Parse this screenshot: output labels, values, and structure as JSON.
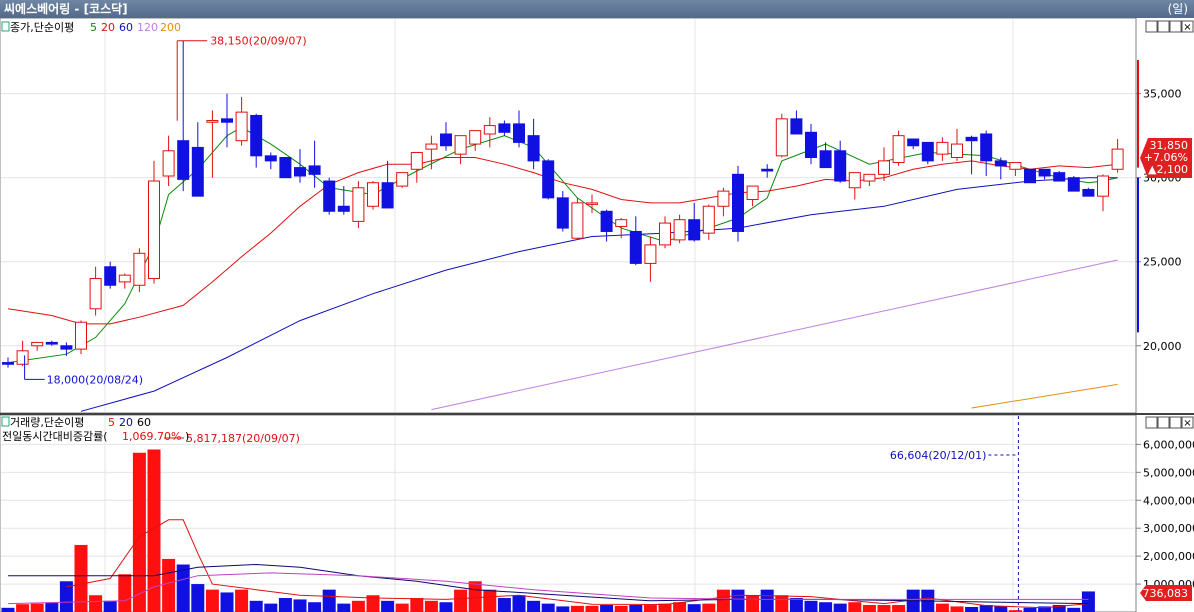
{
  "window": {
    "title": "씨에스베어링 - [코스닥]",
    "period": "(일)"
  },
  "panel_controls": [
    "ㅁ",
    "ㅁ",
    "ㅁ",
    "×"
  ],
  "price_panel": {
    "series_label": "종가,단순이평",
    "ma_periods": [
      "5",
      "20",
      "60",
      "120",
      "200"
    ],
    "ma_colors": [
      "#0a8a0a",
      "#e01010",
      "#1010c0",
      "#c080e0",
      "#e09010"
    ],
    "up_color": "#e01010",
    "down_color": "#1010e0",
    "max_annotation": "38,150(20/09/07)",
    "min_annotation": "18,000(20/08/24)",
    "current": {
      "price": "31,850",
      "change_pct": "+7.06%",
      "change_abs": "▲2,100"
    }
  },
  "volume_panel": {
    "series_label": "거래량,단순이평",
    "ma_periods": [
      "5",
      "20",
      "60"
    ],
    "ratio_label": "전일동시간대비증감률(",
    "ratio_value": "1,069.70%",
    "ratio_close": ")",
    "max_annotation": "5,817,187(20/09/07)",
    "marker_annotation": "66,604(20/12/01)",
    "current_volume": "736,083"
  },
  "chart_data": [
    {
      "type": "candlestick",
      "title": "",
      "xlabel": "",
      "ylabel": "",
      "ylim": [
        16000,
        39500
      ],
      "y_ticks": [
        "20,000",
        "25,000",
        "30,000",
        "35,000"
      ],
      "y_tick_values": [
        20000,
        25000,
        30000,
        35000
      ],
      "ohlc": [
        [
          19000,
          19300,
          18700,
          18900
        ],
        [
          18900,
          20300,
          18800,
          19700
        ],
        [
          20000,
          20200,
          19700,
          20200
        ],
        [
          20200,
          20300,
          20000,
          20100
        ],
        [
          20000,
          20200,
          19400,
          19800
        ],
        [
          19800,
          21500,
          19500,
          21400
        ],
        [
          22200,
          24700,
          21800,
          24000
        ],
        [
          24700,
          25000,
          23400,
          23600
        ],
        [
          23800,
          24300,
          23400,
          24200
        ],
        [
          23600,
          25800,
          23200,
          25500
        ],
        [
          24000,
          31000,
          23700,
          29800
        ],
        [
          30100,
          32500,
          29500,
          31600
        ],
        [
          32200,
          38150,
          29200,
          29900
        ],
        [
          31800,
          33300,
          29400,
          28900
        ],
        [
          33300,
          34000,
          30000,
          33400
        ],
        [
          33500,
          35000,
          31800,
          33300
        ],
        [
          32200,
          34800,
          31900,
          33900
        ],
        [
          33700,
          33800,
          30600,
          31300
        ],
        [
          31300,
          31500,
          30500,
          31000
        ],
        [
          31200,
          31100,
          30000,
          30000
        ],
        [
          30600,
          31700,
          29700,
          30100
        ],
        [
          30700,
          32200,
          29400,
          30200
        ],
        [
          29800,
          30000,
          27800,
          28000
        ],
        [
          28300,
          29500,
          27800,
          28000
        ],
        [
          27400,
          29800,
          27000,
          29400
        ],
        [
          28300,
          29800,
          28100,
          29700
        ],
        [
          29700,
          31000,
          28400,
          28200
        ],
        [
          29500,
          30000,
          29400,
          30300
        ],
        [
          30500,
          31300,
          29700,
          31500
        ],
        [
          31700,
          32500,
          30500,
          32000
        ],
        [
          32600,
          33300,
          31600,
          31900
        ],
        [
          31400,
          32300,
          30800,
          32500
        ],
        [
          32000,
          32000,
          31600,
          32800
        ],
        [
          32600,
          33600,
          31800,
          33100
        ],
        [
          33200,
          33400,
          32500,
          32700
        ],
        [
          33200,
          34000,
          31800,
          32100
        ],
        [
          32500,
          33500,
          30500,
          31000
        ],
        [
          31000,
          31100,
          28700,
          28800
        ],
        [
          28800,
          29200,
          26800,
          27000
        ],
        [
          26400,
          28800,
          26300,
          28500
        ],
        [
          28500,
          29000,
          27900,
          28500
        ],
        [
          28000,
          28100,
          26200,
          26800
        ],
        [
          27100,
          27600,
          26400,
          27500
        ],
        [
          26800,
          27700,
          24800,
          24900
        ],
        [
          24900,
          26500,
          23800,
          26000
        ],
        [
          26000,
          27700,
          25800,
          27300
        ],
        [
          26300,
          27800,
          26100,
          27500
        ],
        [
          27500,
          28500,
          26200,
          26300
        ],
        [
          26700,
          28400,
          26300,
          28300
        ],
        [
          28300,
          29400,
          27700,
          29200
        ],
        [
          30200,
          30700,
          26200,
          26800
        ],
        [
          28700,
          29400,
          28300,
          29500
        ],
        [
          30500,
          30800,
          30000,
          30400
        ],
        [
          31300,
          33800,
          31200,
          33500
        ],
        [
          33500,
          34000,
          32700,
          32600
        ],
        [
          32700,
          33200,
          30800,
          31200
        ],
        [
          31600,
          32100,
          30800,
          30600
        ],
        [
          31600,
          32200,
          29700,
          29800
        ],
        [
          29400,
          29900,
          28700,
          30300
        ],
        [
          29800,
          30000,
          29500,
          30200
        ],
        [
          30200,
          31800,
          29800,
          31000
        ],
        [
          30900,
          32800,
          30700,
          32500
        ],
        [
          32300,
          32300,
          31700,
          31900
        ],
        [
          32100,
          32100,
          30800,
          31000
        ],
        [
          31400,
          32400,
          31000,
          32100
        ],
        [
          31200,
          32900,
          31000,
          32000
        ],
        [
          32400,
          32500,
          30200,
          32200
        ],
        [
          32600,
          32800,
          30100,
          31000
        ],
        [
          31000,
          31200,
          29900,
          30700
        ],
        [
          30500,
          30800,
          30100,
          30900
        ],
        [
          30500,
          30500,
          30000,
          29700
        ],
        [
          30500,
          30500,
          29900,
          30100
        ],
        [
          30300,
          30400,
          29800,
          29800
        ],
        [
          30000,
          30100,
          29200,
          29200
        ],
        [
          29300,
          29400,
          28900,
          28900
        ],
        [
          28900,
          30200,
          28000,
          30100
        ],
        [
          30500,
          32300,
          30300,
          31700
        ]
      ],
      "ma": {
        "5": [
          [
            0,
            19000
          ],
          [
            4,
            19500
          ],
          [
            6,
            20500
          ],
          [
            8,
            22500
          ],
          [
            10,
            26000
          ],
          [
            11,
            29000
          ],
          [
            13,
            30500
          ],
          [
            15,
            32500
          ],
          [
            16,
            33000
          ],
          [
            18,
            32000
          ],
          [
            20,
            30800
          ],
          [
            22,
            29400
          ],
          [
            25,
            29000
          ],
          [
            28,
            30400
          ],
          [
            31,
            31700
          ],
          [
            34,
            32500
          ],
          [
            36,
            31800
          ],
          [
            39,
            28800
          ],
          [
            42,
            27000
          ],
          [
            45,
            26200
          ],
          [
            48,
            27000
          ],
          [
            50,
            27600
          ],
          [
            52,
            28800
          ],
          [
            53,
            31000
          ],
          [
            56,
            32000
          ],
          [
            59,
            30800
          ],
          [
            63,
            31500
          ],
          [
            67,
            31300
          ],
          [
            70,
            30500
          ],
          [
            72,
            30000
          ],
          [
            74,
            29700
          ],
          [
            75,
            29800
          ],
          [
            76,
            30000
          ]
        ],
        "20": [
          [
            0,
            22200
          ],
          [
            3,
            21800
          ],
          [
            5,
            21300
          ],
          [
            7,
            21300
          ],
          [
            9,
            21700
          ],
          [
            12,
            22400
          ],
          [
            14,
            23800
          ],
          [
            16,
            25300
          ],
          [
            18,
            26700
          ],
          [
            20,
            28300
          ],
          [
            22,
            29600
          ],
          [
            24,
            30300
          ],
          [
            26,
            30800
          ],
          [
            28,
            30800
          ],
          [
            30,
            31200
          ],
          [
            32,
            31200
          ],
          [
            34,
            30800
          ],
          [
            36,
            30300
          ],
          [
            38,
            29700
          ],
          [
            40,
            29300
          ],
          [
            42,
            28700
          ],
          [
            44,
            28500
          ],
          [
            46,
            28500
          ],
          [
            48,
            28800
          ],
          [
            50,
            29100
          ],
          [
            52,
            29200
          ],
          [
            54,
            29500
          ],
          [
            56,
            29900
          ],
          [
            58,
            29800
          ],
          [
            60,
            30000
          ],
          [
            62,
            30500
          ],
          [
            64,
            30800
          ],
          [
            66,
            31000
          ],
          [
            68,
            30700
          ],
          [
            70,
            30500
          ],
          [
            72,
            30700
          ],
          [
            74,
            30600
          ],
          [
            76,
            30800
          ]
        ],
        "60": [
          [
            5,
            16100
          ],
          [
            10,
            17300
          ],
          [
            15,
            19300
          ],
          [
            20,
            21500
          ],
          [
            25,
            23100
          ],
          [
            30,
            24500
          ],
          [
            35,
            25600
          ],
          [
            40,
            26500
          ],
          [
            45,
            26700
          ],
          [
            50,
            27000
          ],
          [
            55,
            27800
          ],
          [
            60,
            28300
          ],
          [
            65,
            29300
          ],
          [
            70,
            29800
          ],
          [
            74,
            30000
          ],
          [
            76,
            30000
          ]
        ],
        "120": [
          [
            29,
            16200
          ],
          [
            76,
            25100
          ]
        ],
        "200": [
          [
            66,
            16300
          ],
          [
            76,
            17700
          ]
        ]
      },
      "max_point": {
        "index": 12,
        "value": 38150
      },
      "min_point": {
        "index": 1,
        "value": 18000
      }
    },
    {
      "type": "bar",
      "title": "",
      "xlabel": "",
      "ylabel": "",
      "ylim": [
        0,
        6300000
      ],
      "y_ticks": [
        "1,000,000",
        "2,000,000",
        "3,000,000",
        "4,000,000",
        "5,000,000",
        "6,000,000"
      ],
      "y_tick_values": [
        1000000,
        2000000,
        3000000,
        4000000,
        5000000,
        6000000
      ],
      "volume": [
        150000,
        280000,
        300000,
        320000,
        1100000,
        2400000,
        600000,
        400000,
        1350000,
        5700000,
        5817187,
        1900000,
        1700000,
        1000000,
        800000,
        700000,
        800000,
        400000,
        300000,
        500000,
        450000,
        350000,
        800000,
        300000,
        400000,
        600000,
        400000,
        300000,
        500000,
        400000,
        350000,
        800000,
        1100000,
        800000,
        500000,
        600000,
        400000,
        300000,
        200000,
        220000,
        220000,
        250000,
        220000,
        250000,
        250000,
        300000,
        350000,
        280000,
        300000,
        800000,
        800000,
        600000,
        800000,
        600000,
        500000,
        400000,
        350000,
        300000,
        350000,
        250000,
        250000,
        250000,
        800000,
        800000,
        300000,
        200000,
        180000,
        250000,
        200000,
        66604,
        150000,
        200000,
        250000,
        150000,
        736083
      ],
      "ma": {
        "5": [
          [
            4,
            900000
          ],
          [
            7,
            1200000
          ],
          [
            9,
            2700000
          ],
          [
            11,
            3300000
          ],
          [
            12,
            3300000
          ],
          [
            13,
            2100000
          ],
          [
            14,
            1000000
          ],
          [
            17,
            800000
          ],
          [
            20,
            600000
          ],
          [
            25,
            500000
          ],
          [
            30,
            450000
          ],
          [
            35,
            600000
          ],
          [
            40,
            280000
          ],
          [
            45,
            270000
          ],
          [
            50,
            600000
          ],
          [
            55,
            550000
          ],
          [
            60,
            300000
          ],
          [
            63,
            500000
          ],
          [
            67,
            230000
          ],
          [
            71,
            150000
          ],
          [
            74,
            300000
          ]
        ],
        "20": [
          [
            0,
            1300000
          ],
          [
            10,
            1300000
          ],
          [
            13,
            1600000
          ],
          [
            17,
            1700000
          ],
          [
            20,
            1600000
          ],
          [
            24,
            1300000
          ],
          [
            28,
            1100000
          ],
          [
            32,
            800000
          ],
          [
            38,
            600000
          ],
          [
            44,
            400000
          ],
          [
            50,
            450000
          ],
          [
            56,
            450000
          ],
          [
            62,
            400000
          ],
          [
            68,
            350000
          ],
          [
            74,
            300000
          ]
        ],
        "60": [
          [
            0,
            300000
          ],
          [
            8,
            400000
          ],
          [
            10,
            900000
          ],
          [
            13,
            1300000
          ],
          [
            18,
            1400000
          ],
          [
            24,
            1300000
          ],
          [
            30,
            1100000
          ],
          [
            36,
            800000
          ],
          [
            44,
            500000
          ],
          [
            52,
            450000
          ],
          [
            60,
            450000
          ],
          [
            68,
            450000
          ],
          [
            74,
            450000
          ]
        ]
      },
      "max_point": {
        "index": 10,
        "value": 5817187
      },
      "marker_point": {
        "index": 69,
        "value": 66604
      }
    }
  ]
}
